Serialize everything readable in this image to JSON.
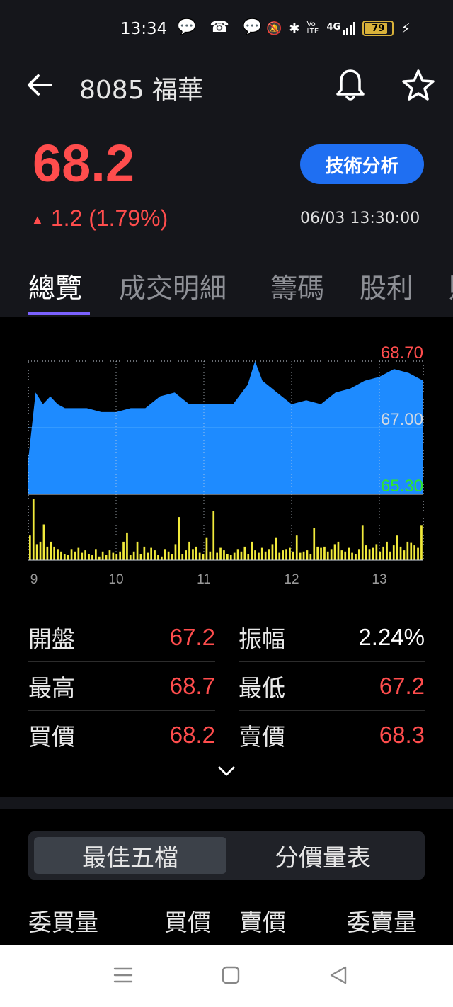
{
  "status_bar": {
    "time": "13:34",
    "left_icons": "💬 ☎ 💬",
    "right_icons": [
      "mute-icon",
      "bluetooth-icon",
      "volte-icon",
      "4g-signal-icon"
    ],
    "volte": "Vo LTE",
    "network": "4G",
    "battery": "79",
    "battery_level": 0.79
  },
  "header": {
    "title": "8085 福華"
  },
  "quote": {
    "price": "68.2",
    "change": "1.2 (1.79%)",
    "timestamp": "06/03 13:30:00",
    "tech_button": "技術分析"
  },
  "tabs": [
    "總覽",
    "成交明細",
    "籌碼",
    "股利",
    "財"
  ],
  "chart_data": {
    "type": "area",
    "series": [
      {
        "name": "price",
        "x": [
          "9:00",
          "9:05",
          "9:10",
          "9:15",
          "9:20",
          "9:25",
          "9:30",
          "9:40",
          "9:50",
          "10:00",
          "10:10",
          "10:20",
          "10:30",
          "10:40",
          "10:50",
          "11:00",
          "11:10",
          "11:20",
          "11:30",
          "11:35",
          "11:40",
          "11:50",
          "12:00",
          "12:10",
          "12:20",
          "12:30",
          "12:40",
          "12:50",
          "13:00",
          "13:10",
          "13:20",
          "13:30"
        ],
        "values": [
          66.2,
          67.9,
          67.6,
          67.8,
          67.6,
          67.5,
          67.5,
          67.5,
          67.4,
          67.4,
          67.5,
          67.5,
          67.8,
          67.9,
          67.6,
          67.6,
          67.6,
          67.6,
          68.1,
          68.7,
          68.2,
          67.9,
          67.6,
          67.7,
          67.6,
          67.9,
          68.0,
          68.2,
          68.3,
          68.5,
          68.4,
          68.2
        ]
      }
    ],
    "yticks": [
      "68.70",
      "67.00",
      "65.30"
    ],
    "xticks": [
      "9",
      "10",
      "11",
      "12",
      "13"
    ],
    "ylim": [
      65.3,
      68.7
    ],
    "volume_bars": [
      40,
      100,
      26,
      30,
      58,
      22,
      30,
      22,
      18,
      14,
      10,
      8,
      18,
      14,
      20,
      12,
      16,
      10,
      8,
      18,
      6,
      14,
      8,
      16,
      12,
      10,
      14,
      30,
      45,
      8,
      14,
      30,
      10,
      22,
      12,
      20,
      16,
      8,
      6,
      18,
      14,
      10,
      26,
      70,
      10,
      16,
      30,
      18,
      22,
      12,
      10,
      36,
      14,
      80,
      12,
      20,
      16,
      10,
      8,
      12,
      18,
      14,
      22,
      10,
      30,
      16,
      12,
      20,
      14,
      18,
      26,
      36,
      12,
      16,
      18,
      20,
      14,
      40,
      12,
      14,
      16,
      10,
      52,
      22,
      20,
      22,
      14,
      18,
      26,
      30,
      16,
      14,
      20,
      12,
      10,
      18,
      56,
      24,
      18,
      20,
      26,
      14,
      22,
      30,
      14,
      24,
      40,
      22,
      16,
      30,
      28,
      24,
      20,
      56
    ]
  },
  "stats": [
    {
      "label": "開盤",
      "value": "67.2",
      "color": "red"
    },
    {
      "label": "振幅",
      "value": "2.24%",
      "color": "white"
    },
    {
      "label": "最高",
      "value": "68.7",
      "color": "red"
    },
    {
      "label": "最低",
      "value": "67.2",
      "color": "red"
    },
    {
      "label": "買價",
      "value": "68.2",
      "color": "red"
    },
    {
      "label": "賣價",
      "value": "68.3",
      "color": "red"
    }
  ],
  "segment": {
    "options": [
      "最佳五檔",
      "分價量表"
    ],
    "selected": 0
  },
  "order_book_headers": [
    "委買量",
    "買價",
    "賣價",
    "委賣量"
  ],
  "colors": {
    "up": "#ff4d4d",
    "down": "#2ee62e",
    "area": "#1e8bff",
    "volume": "#f1ea3b",
    "accent": "#7b61ff",
    "button": "#1f6ff2"
  }
}
